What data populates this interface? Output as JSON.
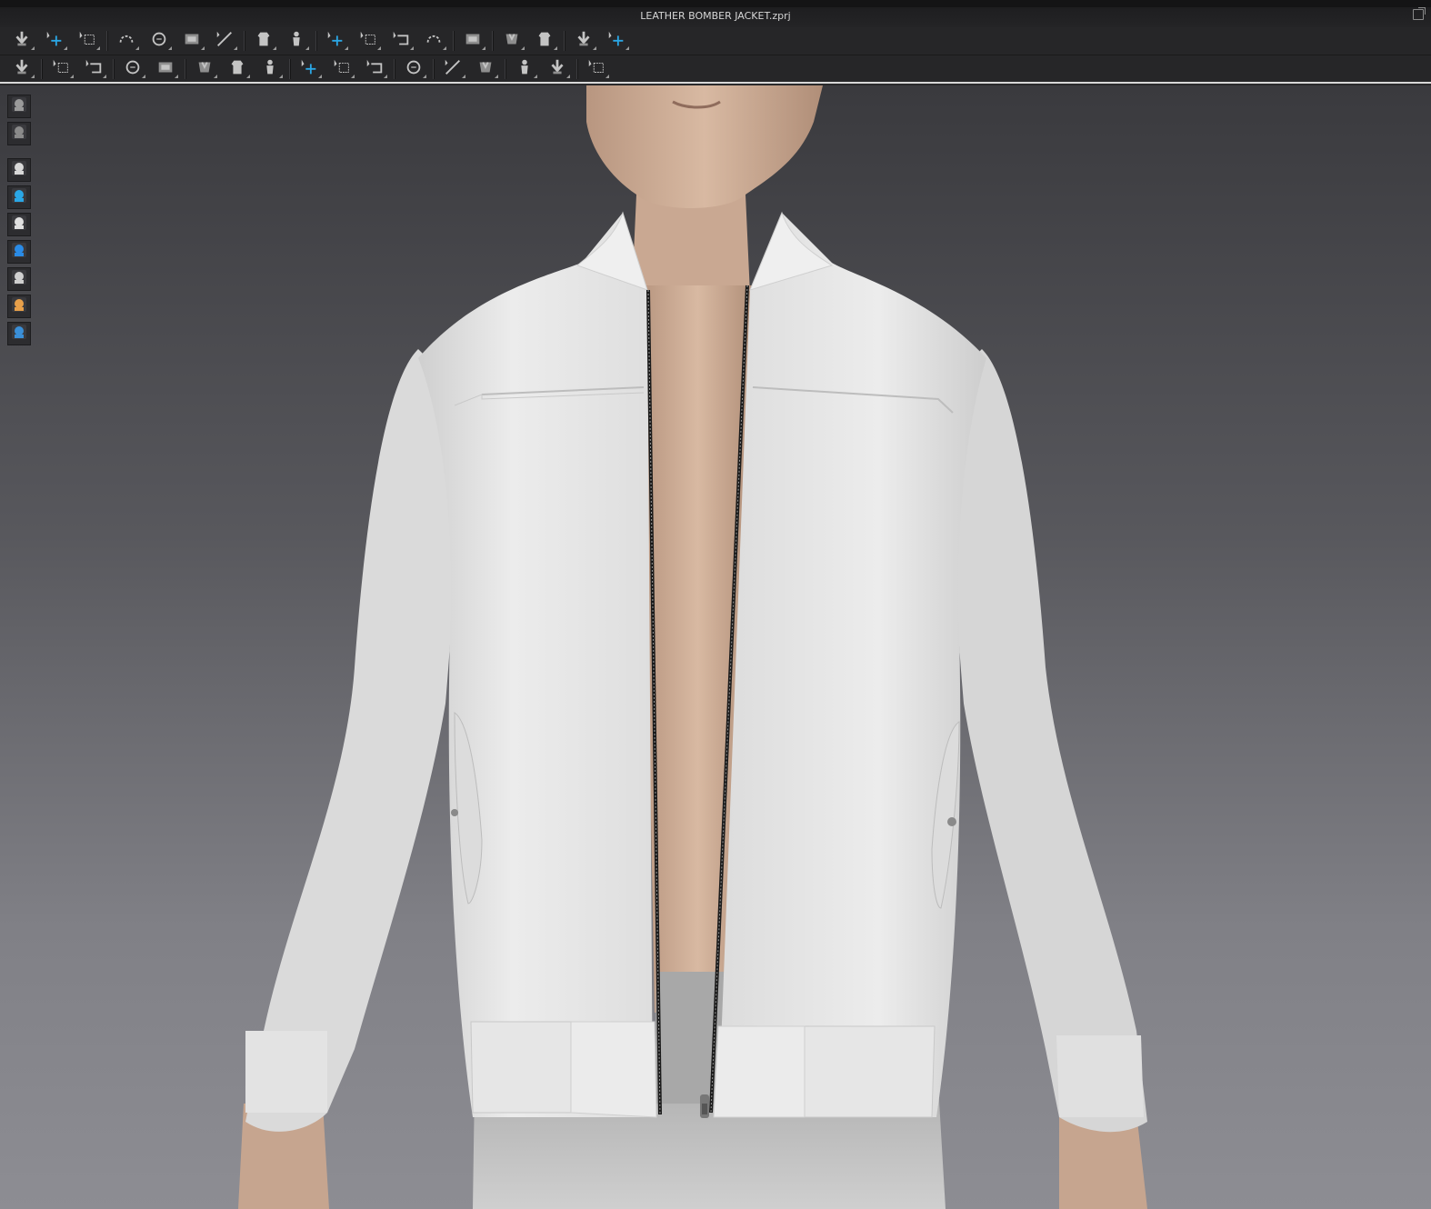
{
  "window": {
    "title": "LEATHER BOMBER JACKET.zprj"
  },
  "toolbar_row1": [
    {
      "name": "simulation-icon"
    },
    {
      "name": "select-move-icon"
    },
    {
      "name": "transform-pattern-icon"
    },
    {
      "sep": true
    },
    {
      "name": "edit-pattern-icon"
    },
    {
      "name": "edit-curvature-icon"
    },
    {
      "name": "edit-curve-point-icon"
    },
    {
      "name": "add-point-icon"
    },
    {
      "sep": true
    },
    {
      "name": "internal-line-icon"
    },
    {
      "name": "circle-internal-icon"
    },
    {
      "sep": true
    },
    {
      "name": "fold-arrangement-icon"
    },
    {
      "name": "show-garment-icon"
    },
    {
      "name": "show-avatar-icon"
    },
    {
      "name": "show-arrangement-icon"
    },
    {
      "sep": true
    },
    {
      "name": "tape-measure-icon"
    },
    {
      "sep": true
    },
    {
      "name": "segment-sewing-icon"
    },
    {
      "name": "pin-icon"
    },
    {
      "sep": true
    },
    {
      "name": "fitting-suit-icon"
    },
    {
      "name": "garment-fit-map-icon"
    }
  ],
  "toolbar_row2": [
    {
      "name": "avatar-motion-icon"
    },
    {
      "sep": true
    },
    {
      "name": "tack-icon"
    },
    {
      "name": "tack-on-avatar-icon"
    },
    {
      "sep": true
    },
    {
      "name": "select-mesh-icon"
    },
    {
      "name": "strengthen-icon"
    },
    {
      "sep": true
    },
    {
      "name": "fold-icon"
    },
    {
      "name": "puckering-icon"
    },
    {
      "name": "quilting-icon"
    },
    {
      "sep": true
    },
    {
      "name": "button-select-icon"
    },
    {
      "name": "button-icon"
    },
    {
      "name": "buttonhole-icon"
    },
    {
      "sep": true
    },
    {
      "name": "zipper-icon"
    },
    {
      "sep": true
    },
    {
      "name": "topstitch-select-icon"
    },
    {
      "name": "topstitch-icon"
    },
    {
      "sep": true
    },
    {
      "name": "piping-select-icon"
    },
    {
      "name": "piping-icon"
    },
    {
      "sep": true
    },
    {
      "name": "measure-axis-icon"
    }
  ],
  "sidebar": [
    {
      "name": "fabric-display-icon"
    },
    {
      "name": "texture-display-icon"
    },
    {
      "gap": true
    },
    {
      "name": "garment-shirt-icon"
    },
    {
      "name": "color-drop-icon"
    },
    {
      "name": "avatar-figure-icon"
    },
    {
      "name": "shoe-icon"
    },
    {
      "name": "hair-icon"
    },
    {
      "name": "avatar-skin-icon"
    },
    {
      "name": "environment-globe-icon"
    }
  ],
  "colors": {
    "jacket": "#e9e9e9",
    "skin": "#caa88f",
    "pants": "#b7b7b7",
    "zipper": "#1a1a1a",
    "accent": "#2aa7e6"
  }
}
